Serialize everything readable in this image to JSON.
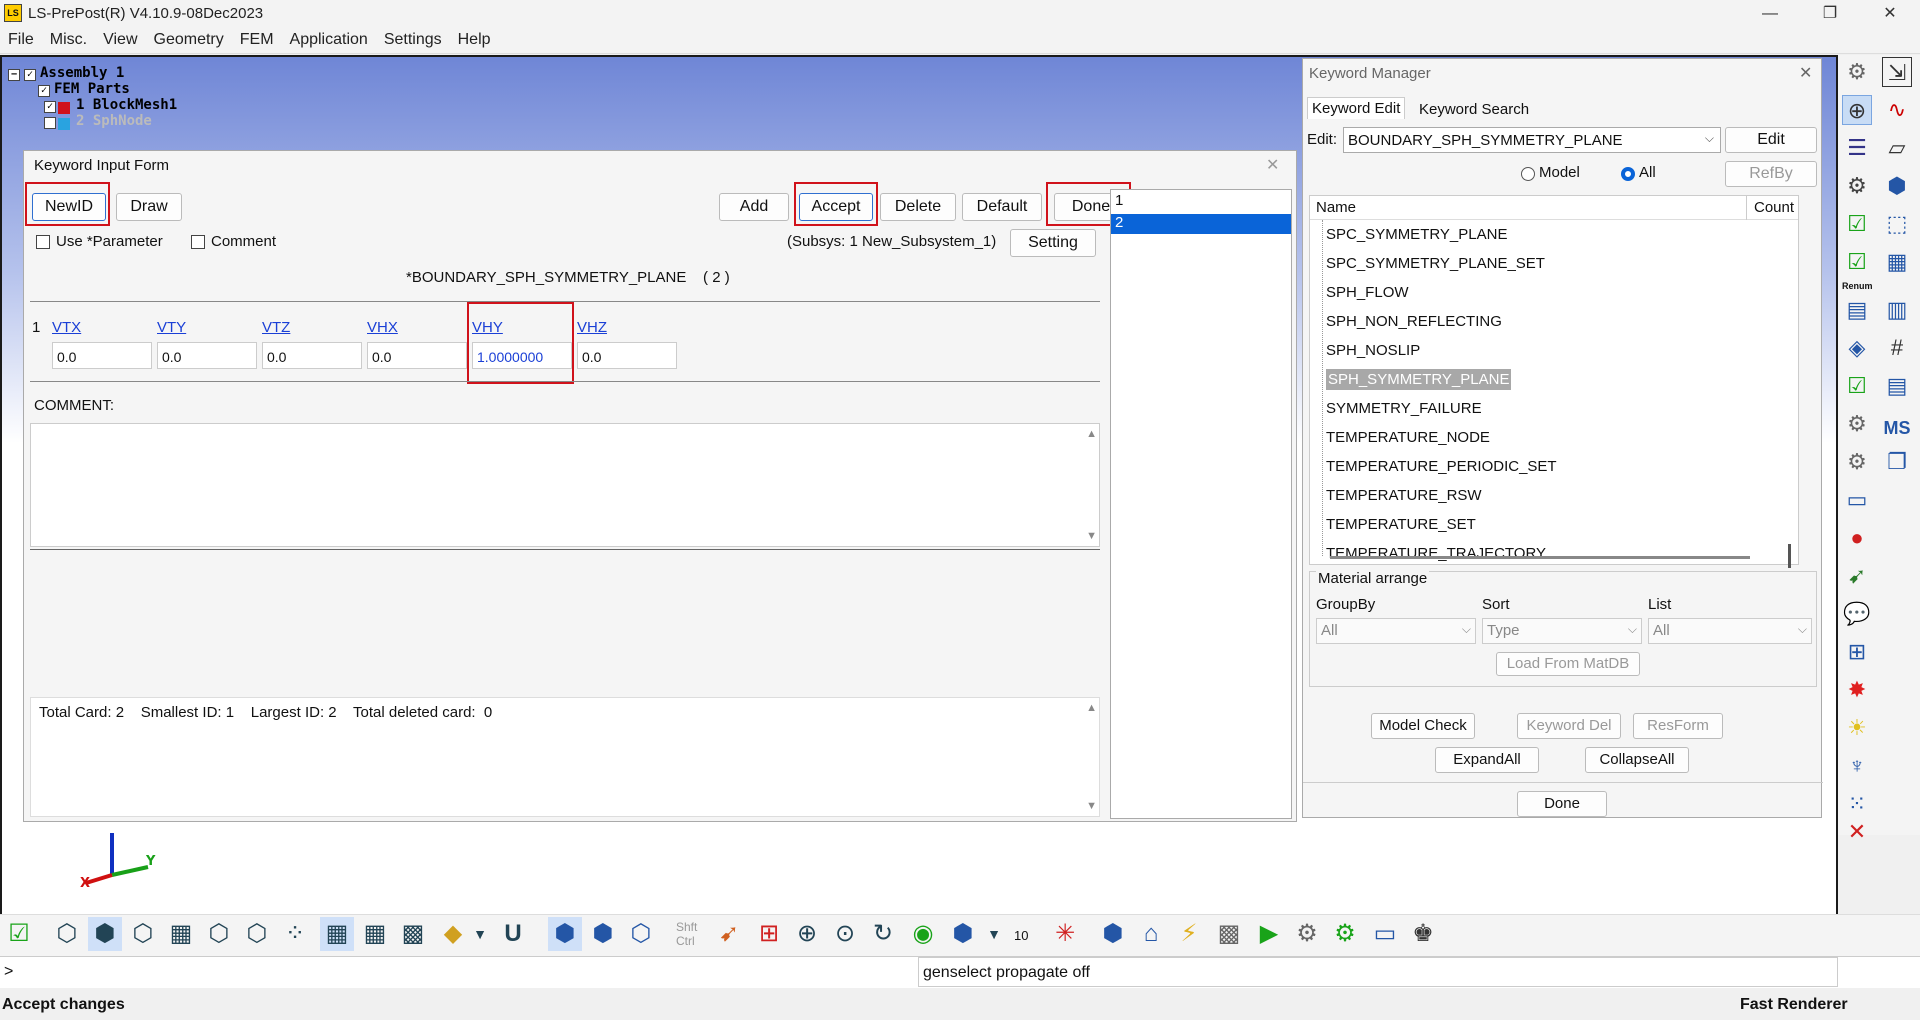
{
  "app": {
    "title": "LS-PrePost(R) V4.10.9-08Dec2023",
    "logo": "LS"
  },
  "window_controls": {
    "minimize": "—",
    "maximize": "❐",
    "close": "✕"
  },
  "menu": [
    "File",
    "Misc.",
    "View",
    "Geometry",
    "FEM",
    "Application",
    "Settings",
    "Help"
  ],
  "tree": {
    "assembly": "Assembly 1",
    "fem_parts": "FEM Parts",
    "part1": "1 BlockMesh1",
    "part2": "2 SphNode"
  },
  "kif": {
    "title": "Keyword Input Form",
    "close": "✕",
    "newid": "NewID",
    "draw": "Draw",
    "add": "Add",
    "accept": "Accept",
    "delete": "Delete",
    "default": "Default",
    "done": "Done",
    "use_parameter": "Use *Parameter",
    "comment_check": "Comment",
    "subsys": "(Subsys: 1 New_Subsystem_1)",
    "setting": "Setting",
    "keyword_title": "*BOUNDARY_SPH_SYMMETRY_PLANE    ( 2 )",
    "row_num": "1",
    "fields": [
      {
        "label": "VTX",
        "value": "0.0"
      },
      {
        "label": "VTY",
        "value": "0.0"
      },
      {
        "label": "VTZ",
        "value": "0.0"
      },
      {
        "label": "VHX",
        "value": "0.0"
      },
      {
        "label": "VHY",
        "value": "1.0000000"
      },
      {
        "label": "VHZ",
        "value": "0.0"
      }
    ],
    "comment_label": "COMMENT:",
    "status": "Total Card: 2    Smallest ID: 1    Largest ID: 2    Total deleted card:  0",
    "id_list": [
      "1",
      "2"
    ],
    "selected_id": "2"
  },
  "km": {
    "title": "Keyword Manager",
    "close": "✕",
    "tabs": [
      "Keyword Edit",
      "Keyword Search"
    ],
    "edit_label": "Edit:",
    "edit_value": "BOUNDARY_SPH_SYMMETRY_PLANE",
    "edit_btn": "Edit",
    "radio_model": "Model",
    "radio_all": "All",
    "refby": "RefBy",
    "col_name": "Name",
    "col_count": "Count",
    "items": [
      "SPC_SYMMETRY_PLANE",
      "SPC_SYMMETRY_PLANE_SET",
      "SPH_FLOW",
      "SPH_NON_REFLECTING",
      "SPH_NOSLIP",
      "SPH_SYMMETRY_PLANE",
      "SYMMETRY_FAILURE",
      "TEMPERATURE_NODE",
      "TEMPERATURE_PERIODIC_SET",
      "TEMPERATURE_RSW",
      "TEMPERATURE_SET",
      "TEMPERATURE_TRAJECTORY"
    ],
    "selected_item": "SPH_SYMMETRY_PLANE",
    "material_arrange": "Material arrange",
    "groupby_label": "GroupBy",
    "sort_label": "Sort",
    "list_label": "List",
    "groupby_value": "All",
    "sort_value": "Type",
    "list_value": "All",
    "load_matdb": "Load From MatDB",
    "model_check": "Model Check",
    "keyword_del": "Keyword Del",
    "resform": "ResForm",
    "expand_all": "ExpandAll",
    "collapse_all": "CollapseAll",
    "done": "Done"
  },
  "right_toolbar_labels": {
    "renum": "Renum",
    "ms": "MS"
  },
  "bottom": {
    "shft_ctrl": "Shft\nCtrl",
    "zoom_val": "10",
    "prompt": ">",
    "console": "genselect propagate off",
    "status_left": "Accept changes",
    "status_right": "Fast Renderer"
  },
  "colors": {
    "highlight": "#d0121b",
    "selection": "#0a64d8",
    "link": "#1a3fd6"
  }
}
